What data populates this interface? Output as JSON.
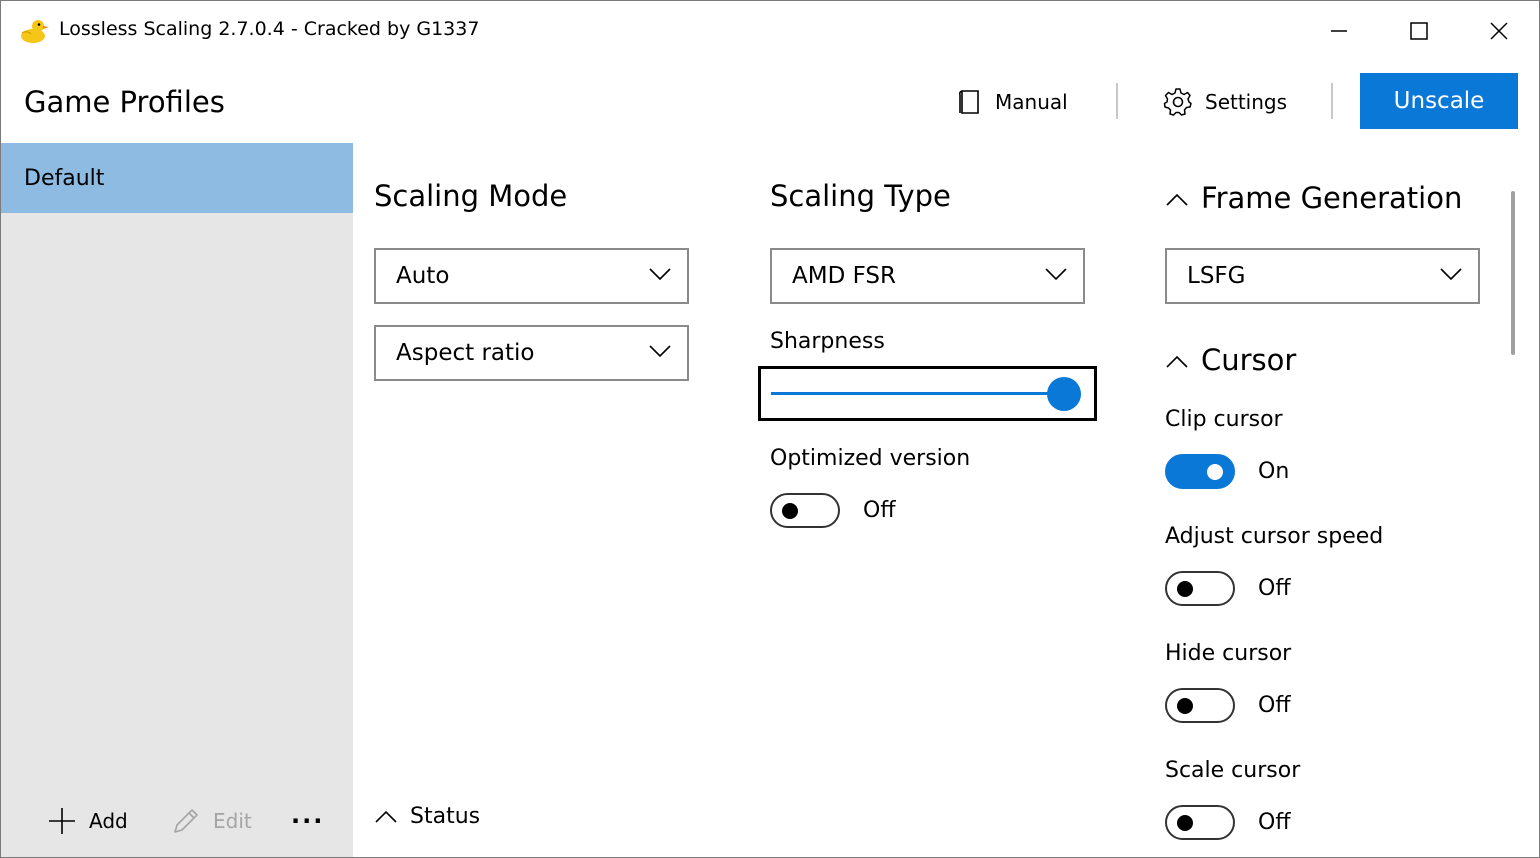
{
  "window": {
    "title": "Lossless Scaling 2.7.0.4 - Cracked by G1337"
  },
  "header": {
    "page_title": "Game Profiles",
    "manual_label": "Manual",
    "settings_label": "Settings",
    "unscale_label": "Unscale"
  },
  "sidebar": {
    "profiles": [
      {
        "label": "Default",
        "selected": true
      }
    ],
    "add_label": "Add",
    "edit_label": "Edit",
    "more_label": "···"
  },
  "scaling_mode": {
    "title": "Scaling Mode",
    "mode_value": "Auto",
    "aspect_value": "Aspect ratio"
  },
  "scaling_type": {
    "title": "Scaling Type",
    "type_value": "AMD FSR",
    "sharpness_label": "Sharpness",
    "sharpness_fraction": 1.0,
    "optimized_label": "Optimized version",
    "optimized_state": "Off"
  },
  "frame_generation": {
    "title": "Frame Generation",
    "value": "LSFG"
  },
  "cursor": {
    "title": "Cursor",
    "clip_label": "Clip cursor",
    "clip_state": "On",
    "adjust_label": "Adjust cursor speed",
    "adjust_state": "Off",
    "hide_label": "Hide cursor",
    "hide_state": "Off",
    "scale_label": "Scale cursor",
    "scale_state": "Off"
  },
  "status": {
    "title": "Status"
  },
  "colors": {
    "accent": "#0a78d7",
    "selected_profile": "#8dbbe2",
    "sidebar_bg": "#e6e6e6"
  }
}
